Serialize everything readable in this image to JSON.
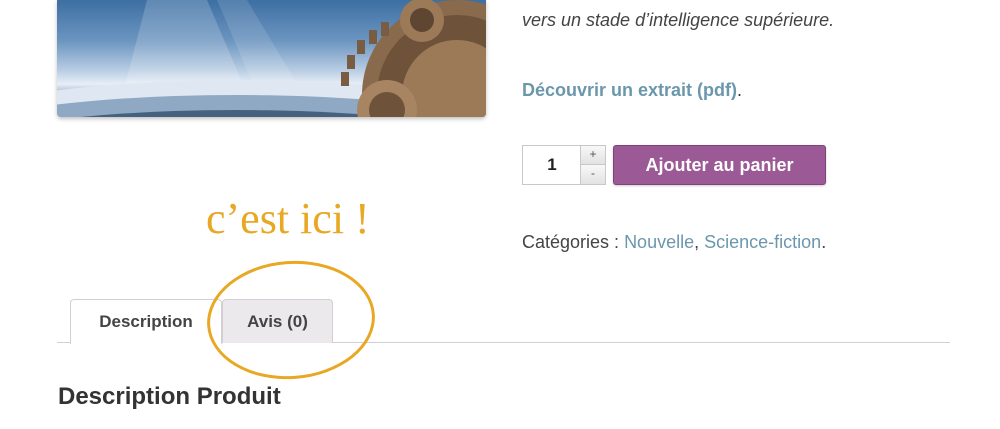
{
  "product": {
    "tagline": "vers un stade d’intelligence supérieure.",
    "excerpt_link": "Découvrir un extrait (pdf)",
    "excerpt_suffix": "."
  },
  "cart": {
    "quantity": "1",
    "plus_label": "+",
    "minus_label": "-",
    "add_to_cart_label": "Ajouter au panier"
  },
  "categories": {
    "label": "Catégories : ",
    "items": [
      "Nouvelle",
      "Science-fiction"
    ],
    "separator": ", ",
    "suffix": "."
  },
  "annotation": {
    "text": "c’est ici !"
  },
  "tabs": [
    {
      "label": "Description",
      "active": true
    },
    {
      "label": "Avis (0)",
      "active": false
    }
  ],
  "section": {
    "title": "Description Produit"
  },
  "colors": {
    "link": "#6b97ad",
    "button": "#9b5a95",
    "annotation": "#e8a824"
  }
}
